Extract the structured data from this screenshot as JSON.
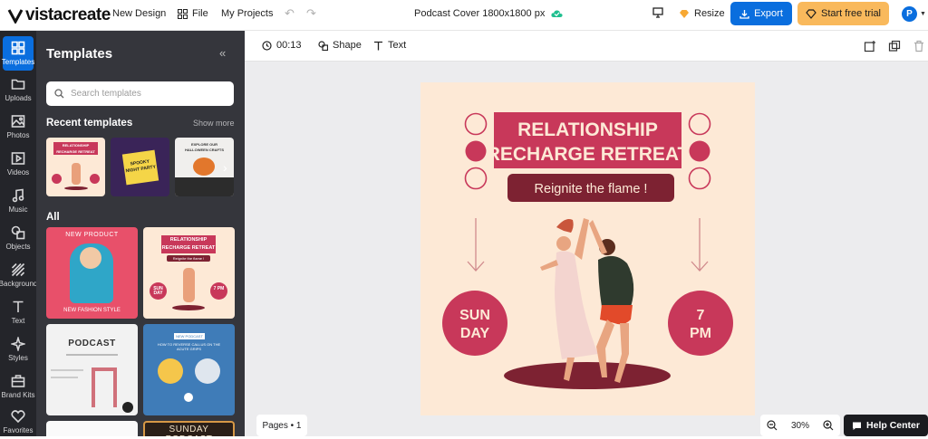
{
  "topbar": {
    "logo": "vistacreate",
    "new_design": "New Design",
    "file": "File",
    "my_projects": "My Projects",
    "doc_title": "Podcast Cover 1800x1800 px",
    "resize": "Resize",
    "export": "Export",
    "trial": "Start free trial",
    "avatar_initial": "P"
  },
  "rail": {
    "items": [
      {
        "label": "Templates",
        "icon": "templates-icon"
      },
      {
        "label": "Uploads",
        "icon": "folder-icon"
      },
      {
        "label": "Photos",
        "icon": "image-icon"
      },
      {
        "label": "Videos",
        "icon": "video-icon"
      },
      {
        "label": "Music",
        "icon": "music-icon"
      },
      {
        "label": "Objects",
        "icon": "objects-icon"
      },
      {
        "label": "Background",
        "icon": "background-icon"
      },
      {
        "label": "Text",
        "icon": "text-icon"
      },
      {
        "label": "Styles",
        "icon": "styles-icon"
      },
      {
        "label": "Brand Kits",
        "icon": "briefcase-icon"
      },
      {
        "label": "Favorites",
        "icon": "heart-icon"
      }
    ]
  },
  "panel": {
    "title": "Templates",
    "search_placeholder": "Search templates",
    "recent_heading": "Recent templates",
    "show_more": "Show more",
    "all_heading": "All",
    "recent": [
      {
        "line1": "RELATIONSHIP",
        "line2": "RECHARGE RETREAT"
      },
      {
        "line1": "SPOOKY",
        "line2": "NIGHT PARTY"
      },
      {
        "line1": "EXPLORE OUR",
        "line2": "HALLOWEEN CRAFTS"
      }
    ],
    "all": [
      {
        "top": "NEW PRODUCT",
        "bottom": "NEW FASHION STYLE"
      },
      {
        "line1": "RELATIONSHIP",
        "line2": "RECHARGE RETREAT",
        "tag": "Reignite the flame !",
        "left": "SUN DAY",
        "right": "7 PM"
      },
      {
        "title": "PODCAST"
      },
      {
        "tag": "NEW PODCAST",
        "title": "HOW TO REVERSE CALLUS ON THE ACUTE GRIPS"
      },
      {
        "title": ""
      },
      {
        "title": "SUNDAY PODCAST"
      }
    ]
  },
  "ctxbar": {
    "duration": "00:13",
    "shape": "Shape",
    "text": "Text"
  },
  "design": {
    "line1": "RELATIONSHIP",
    "line2": "RECHARGE RETREAT",
    "tagline": "Reignite the flame !",
    "left_badge_1": "SUN",
    "left_badge_2": "DAY",
    "right_badge_1": "7",
    "right_badge_2": "PM",
    "colors": {
      "bg": "#fde9d6",
      "accent": "#c8385a",
      "dark": "#7d2232"
    }
  },
  "footer": {
    "pages": "Pages • 1",
    "zoom": "30%",
    "help": "Help Center"
  }
}
